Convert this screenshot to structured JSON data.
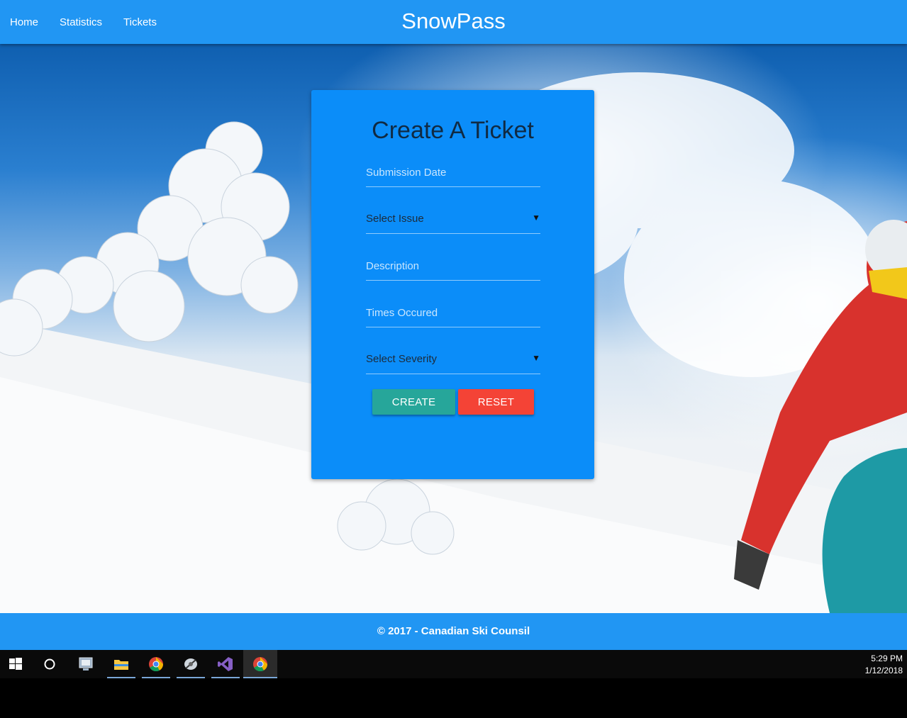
{
  "navbar": {
    "links": [
      "Home",
      "Statistics",
      "Tickets"
    ],
    "brand": "SnowPass"
  },
  "form": {
    "title": "Create A Ticket",
    "submission_date_placeholder": "Submission Date",
    "issue_select_label": "Select Issue",
    "description_placeholder": "Description",
    "times_occured_placeholder": "Times Occured",
    "severity_select_label": "Select Severity",
    "dropdown_arrow": "▼",
    "create_button": "CREATE",
    "reset_button": "RESET"
  },
  "footer": {
    "text": "© 2017 - Canadian Ski Counsil"
  },
  "taskbar": {
    "items": [
      "windows-start-icon",
      "cortana-search-icon",
      "task-view-icon",
      "file-explorer-icon",
      "chrome-icon",
      "audio-app-icon",
      "visual-studio-icon",
      "chrome-icon"
    ],
    "time": "5:29 PM",
    "date": "1/12/2018"
  },
  "colors": {
    "navbar": "#2196f3",
    "card": "#0b8df9",
    "create": "#26a69a",
    "reset": "#f44336"
  }
}
